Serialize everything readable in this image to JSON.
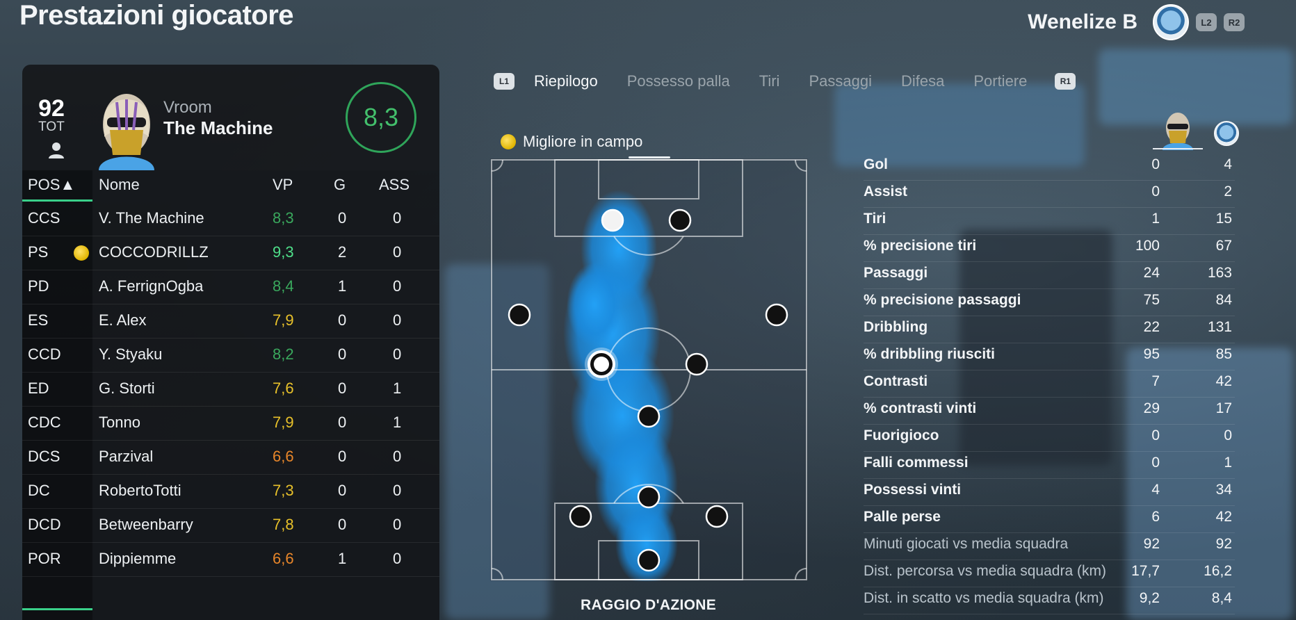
{
  "page_title": "Prestazioni giocatore",
  "header": {
    "club_name": "Wenelize B",
    "l2_label": "L2",
    "r2_label": "R2"
  },
  "player": {
    "overall": "92",
    "overall_label": "TOT",
    "first_name": "Vroom",
    "last_name": "The Machine",
    "match_rating": "8,3",
    "rating_color": "#43c06c"
  },
  "table": {
    "columns": {
      "pos": "POS▲",
      "name": "Nome",
      "vp": "VP",
      "g": "G",
      "ass": "ASS"
    },
    "rows": [
      {
        "pos": "CCS",
        "name": "V. The Machine",
        "vp": "8,3",
        "g": "0",
        "ass": "0",
        "color": "#3aa85d",
        "motm": false
      },
      {
        "pos": "PS",
        "name": "COCCODRILLZ",
        "vp": "9,3",
        "g": "2",
        "ass": "0",
        "color": "#4fe08a",
        "motm": true
      },
      {
        "pos": "PD",
        "name": "A. FerrignOgba",
        "vp": "8,4",
        "g": "1",
        "ass": "0",
        "color": "#3aa85d",
        "motm": false
      },
      {
        "pos": "ES",
        "name": "E. Alex",
        "vp": "7,9",
        "g": "0",
        "ass": "0",
        "color": "#e8c12a",
        "motm": false
      },
      {
        "pos": "CCD",
        "name": "Y. Styaku",
        "vp": "8,2",
        "g": "0",
        "ass": "0",
        "color": "#3aa85d",
        "motm": false
      },
      {
        "pos": "ED",
        "name": "G. Storti",
        "vp": "7,6",
        "g": "0",
        "ass": "1",
        "color": "#e8c12a",
        "motm": false
      },
      {
        "pos": "CDC",
        "name": "Tonno",
        "vp": "7,9",
        "g": "0",
        "ass": "1",
        "color": "#e8c12a",
        "motm": false
      },
      {
        "pos": "DCS",
        "name": "Parzival",
        "vp": "6,6",
        "g": "0",
        "ass": "0",
        "color": "#e8862a",
        "motm": false
      },
      {
        "pos": "DC",
        "name": "RobertoTotti",
        "vp": "7,3",
        "g": "0",
        "ass": "0",
        "color": "#e8c12a",
        "motm": false
      },
      {
        "pos": "DCD",
        "name": "Betweenbarry",
        "vp": "7,8",
        "g": "0",
        "ass": "0",
        "color": "#e8c12a",
        "motm": false
      },
      {
        "pos": "POR",
        "name": "Dippiemme",
        "vp": "6,6",
        "g": "1",
        "ass": "0",
        "color": "#e8862a",
        "motm": false
      }
    ]
  },
  "tabs": {
    "l1_label": "L1",
    "r1_label": "R1",
    "items": [
      {
        "label": "Riepilogo",
        "active": true
      },
      {
        "label": "Possesso palla",
        "active": false
      },
      {
        "label": "Tiri",
        "active": false
      },
      {
        "label": "Passaggi",
        "active": false
      },
      {
        "label": "Difesa",
        "active": false
      },
      {
        "label": "Portiere",
        "active": false
      }
    ]
  },
  "motm_label": "Migliore in campo",
  "heatmap_label": "RAGGIO D'AZIONE",
  "stats": [
    {
      "label": "Gol",
      "player": "0",
      "team": "4",
      "dim": false
    },
    {
      "label": "Assist",
      "player": "0",
      "team": "2",
      "dim": false
    },
    {
      "label": "Tiri",
      "player": "1",
      "team": "15",
      "dim": false
    },
    {
      "label": "% precisione tiri",
      "player": "100",
      "team": "67",
      "dim": false
    },
    {
      "label": "Passaggi",
      "player": "24",
      "team": "163",
      "dim": false
    },
    {
      "label": "% precisione passaggi",
      "player": "75",
      "team": "84",
      "dim": false
    },
    {
      "label": "Dribbling",
      "player": "22",
      "team": "131",
      "dim": false
    },
    {
      "label": "% dribbling riusciti",
      "player": "95",
      "team": "85",
      "dim": false
    },
    {
      "label": "Contrasti",
      "player": "7",
      "team": "42",
      "dim": false
    },
    {
      "label": "% contrasti vinti",
      "player": "29",
      "team": "17",
      "dim": false
    },
    {
      "label": "Fuorigioco",
      "player": "0",
      "team": "0",
      "dim": false
    },
    {
      "label": "Falli commessi",
      "player": "0",
      "team": "1",
      "dim": false
    },
    {
      "label": "Possessi vinti",
      "player": "4",
      "team": "34",
      "dim": false
    },
    {
      "label": "Palle perse",
      "player": "6",
      "team": "42",
      "dim": false
    },
    {
      "label": "Minuti giocati vs media squadra",
      "player": "92",
      "team": "92",
      "dim": true
    },
    {
      "label": "Dist. percorsa vs media squadra (km)",
      "player": "17,7",
      "team": "16,2",
      "dim": true
    },
    {
      "label": "Dist. in scatto vs media squadra (km)",
      "player": "9,2",
      "team": "8,4",
      "dim": true
    }
  ]
}
